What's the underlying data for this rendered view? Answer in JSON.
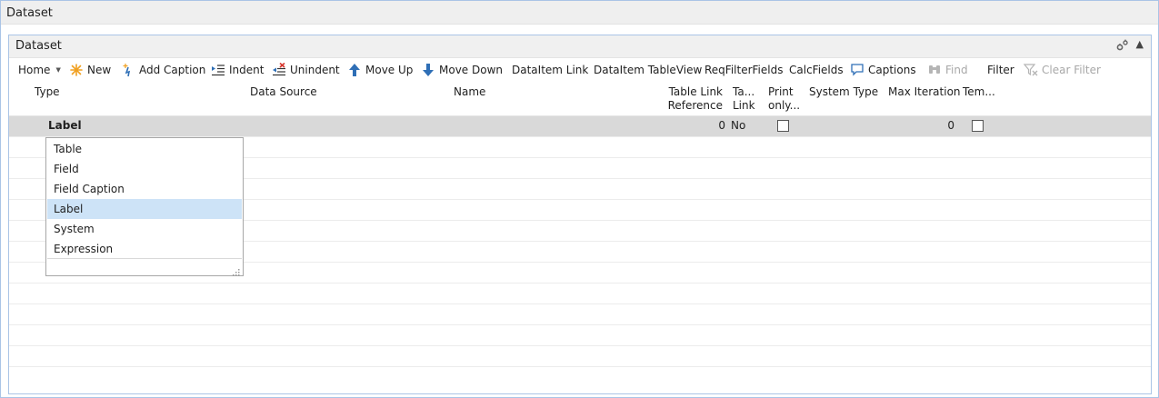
{
  "page": {
    "title": "Dataset"
  },
  "part": {
    "title": "Dataset"
  },
  "toolbar": {
    "home": "Home",
    "new": "New",
    "add_caption": "Add Caption",
    "indent": "Indent",
    "unindent": "Unindent",
    "move_up": "Move Up",
    "move_down": "Move Down",
    "dataitem_link": "DataItem Link",
    "dataitem_tableview": "DataItem TableView",
    "reqfilterfields": "ReqFilterFields",
    "calcfields": "CalcFields",
    "captions": "Captions",
    "find": "Find",
    "filter": "Filter",
    "clear_filter": "Clear Filter"
  },
  "columns": {
    "type": "Type",
    "data_source": "Data Source",
    "name": "Name",
    "table_link_ref_1": "Table Link",
    "table_link_ref_2": "Reference",
    "ta_link_1": "Ta...",
    "ta_link_2": "Link",
    "print_only_1": "Print",
    "print_only_2": "only...",
    "system_type": "System Type",
    "max_iteration": "Max Iteration",
    "tem": "Tem..."
  },
  "row": {
    "type": "Label",
    "table_link_reference": "0",
    "ta_link": "No",
    "print_only": false,
    "max_iteration": "0",
    "tem": false
  },
  "dropdown": {
    "options": [
      "Table",
      "Field",
      "Field Caption",
      "Label",
      "System",
      "Expression"
    ],
    "selected": "Label"
  },
  "colors": {
    "accent_border": "#aac4e6",
    "selected_row": "#d9d9d9",
    "dropdown_highlight": "#cde3f7",
    "icon_blue": "#2f6fb6",
    "icon_red": "#d6342b",
    "icon_orange": "#f0a020"
  }
}
